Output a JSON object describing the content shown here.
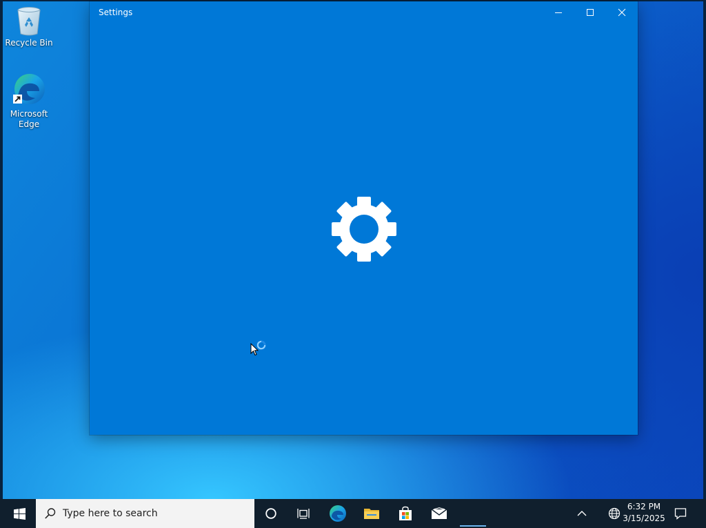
{
  "desktop": {
    "icons": [
      {
        "label": "Recycle Bin",
        "icon": "recycle-bin-icon"
      },
      {
        "label": "Microsoft Edge",
        "icon": "edge-icon"
      }
    ]
  },
  "window": {
    "title": "Settings",
    "controls": {
      "minimize": "minimize-icon",
      "maximize": "maximize-icon",
      "close": "close-icon"
    },
    "splash_icon": "settings-gear-icon",
    "accent": "#0078d7"
  },
  "cursor": {
    "state": "busy"
  },
  "taskbar": {
    "background": "#101f2d",
    "start_icon": "windows-logo-icon",
    "search": {
      "placeholder": "Type here to search",
      "icon": "search-icon"
    },
    "pinned": [
      "cortana-icon",
      "task-view-icon",
      "edge-icon",
      "file-explorer-icon",
      "microsoft-store-icon",
      "mail-icon"
    ],
    "tray": {
      "chevron_icon": "chevron-up-icon",
      "network_icon": "network-globe-icon",
      "time": "6:32 PM",
      "date": "3/15/2025",
      "notification_icon": "action-center-icon"
    }
  }
}
